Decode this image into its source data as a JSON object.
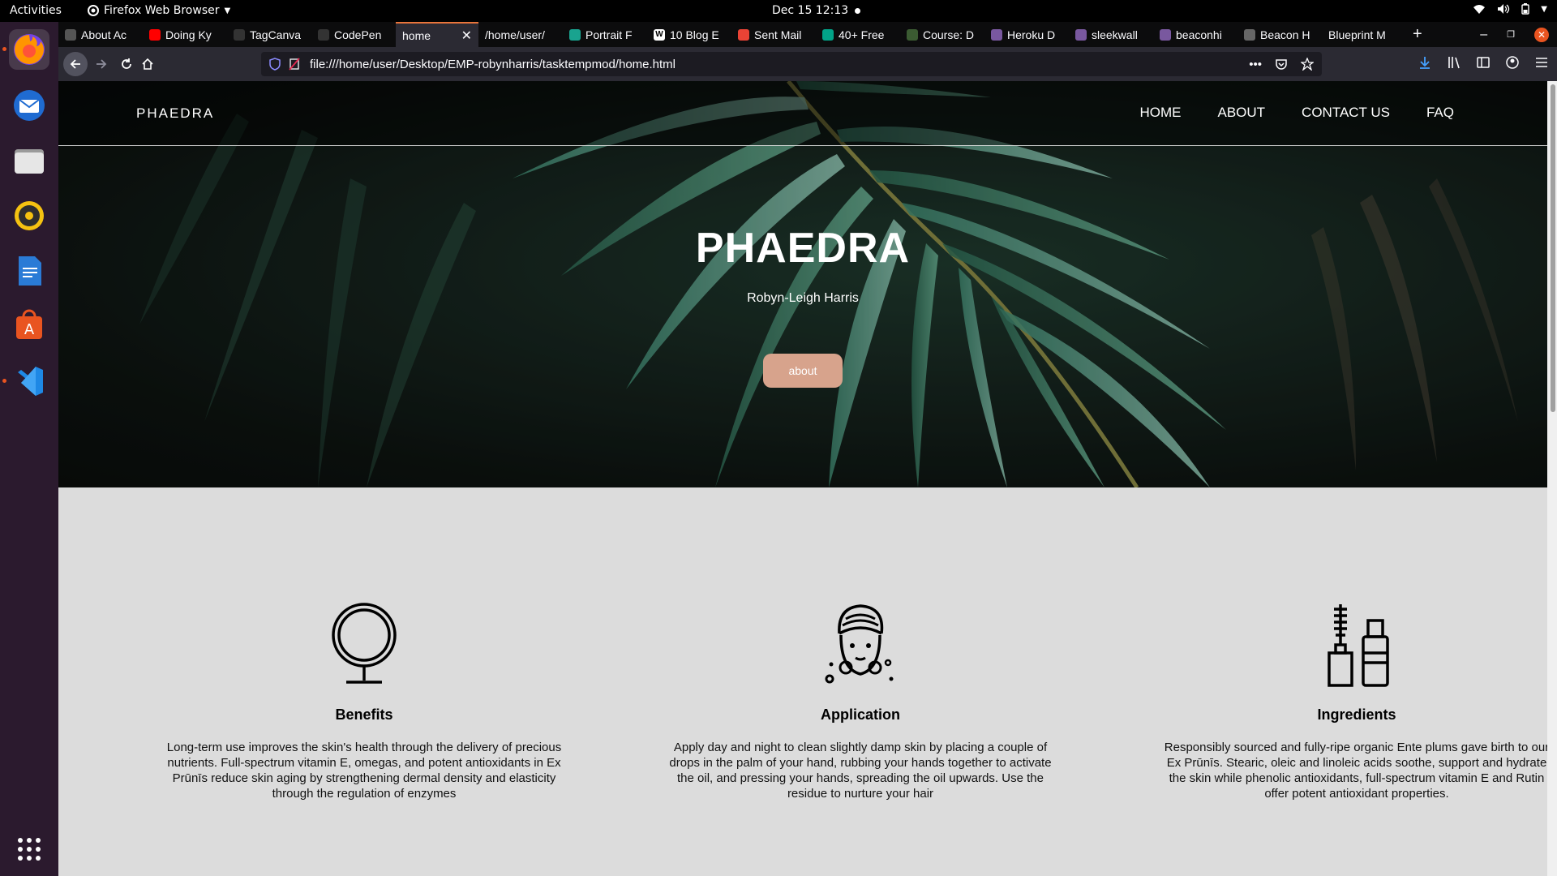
{
  "topbar": {
    "activities": "Activities",
    "app_name": "Firefox Web Browser",
    "clock": "Dec 15  12:13"
  },
  "dock": {
    "items": [
      "firefox-icon",
      "thunderbird-icon",
      "files-icon",
      "rhythmbox-icon",
      "writer-icon",
      "software-icon",
      "vscode-icon",
      "app-grid-icon"
    ]
  },
  "browser": {
    "tabs": [
      {
        "label": "About Ac",
        "icon": "about-icon"
      },
      {
        "label": "Doing Ky",
        "icon": "youtube-icon"
      },
      {
        "label": "TagCanva",
        "icon": "codepen-icon"
      },
      {
        "label": "CodePen",
        "icon": "codepen-icon"
      },
      {
        "label": "home",
        "icon": "",
        "active": true
      },
      {
        "label": "/home/user/",
        "icon": ""
      },
      {
        "label": "Portrait F",
        "icon": "portrait-icon"
      },
      {
        "label": "10 Blog E",
        "icon": "wix-icon"
      },
      {
        "label": "Sent Mail",
        "icon": "gmail-icon"
      },
      {
        "label": "40+ Free",
        "icon": "px-icon"
      },
      {
        "label": "Course: D",
        "icon": "course-icon"
      },
      {
        "label": "Heroku D",
        "icon": "heroku-icon"
      },
      {
        "label": "sleekwall",
        "icon": "heroku-icon"
      },
      {
        "label": "beaconhi",
        "icon": "heroku-icon"
      },
      {
        "label": "Beacon H",
        "icon": "beacon-icon"
      },
      {
        "label": "Blueprint M",
        "icon": ""
      }
    ],
    "url": "file:///home/user/Desktop/EMP-robynharris/tasktempmod/home.html"
  },
  "site": {
    "logo": "PHAEDRA",
    "nav": [
      "HOME",
      "ABOUT",
      "CONTACT US",
      "FAQ"
    ],
    "hero": {
      "title": "PHAEDRA",
      "subtitle": "Robyn-Leigh Harris",
      "button": "about"
    },
    "features": [
      {
        "icon": "mirror-icon",
        "title": "Benefits",
        "text": "Long-term use improves the skin's health through the delivery of precious nutrients. Full-spectrum vitamin E, omegas, and potent antioxidants in Ex Prūnīs reduce skin aging by strengthening dermal density and elasticity through the regulation of enzymes"
      },
      {
        "icon": "face-towel-icon",
        "title": "Application",
        "text": "Apply day and night to clean slightly damp skin by placing a couple of drops in the palm of your hand, rubbing your hands together to activate the oil, and pressing your hands, spreading the oil upwards. Use the residue to nurture your hair"
      },
      {
        "icon": "mascara-bottle-icon",
        "title": "Ingredients",
        "text": "Responsibly sourced and fully-ripe organic Ente plums gave birth to our Ex Prūnīs. Stearic, oleic and linoleic acids soothe, support and hydrate the skin while phenolic antioxidants, full-spectrum vitamin E and Rutin offer potent antioxidant properties."
      }
    ]
  },
  "colors": {
    "accent_button": "#d7a38c",
    "feature_bg": "#dcdcdc",
    "ubuntu_orange": "#e95420"
  }
}
